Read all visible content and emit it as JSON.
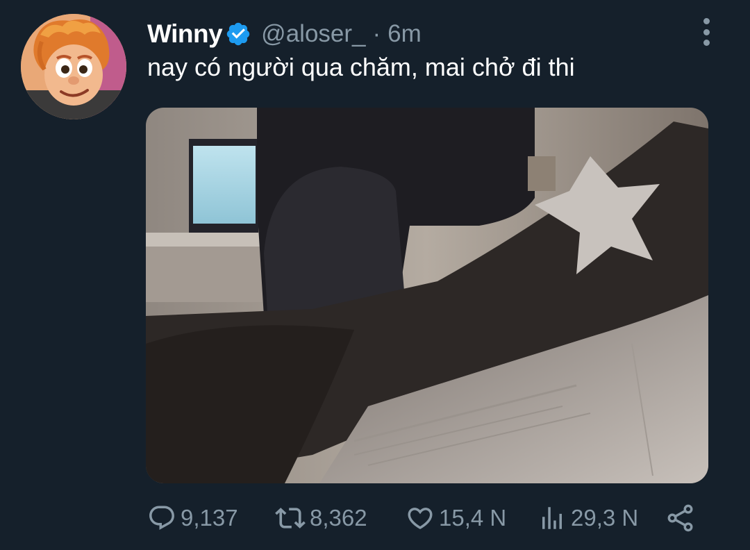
{
  "tweet": {
    "author": {
      "name": "Winny",
      "handle": "@aloser_",
      "verified": true
    },
    "separator": "·",
    "time": "6m",
    "text": "nay có người qua chăm, mai chở đi thi",
    "actions": {
      "replies": "9,137",
      "retweets": "8,362",
      "likes": "15,4 N",
      "views": "29,3 N"
    }
  },
  "icons": {
    "reply": "reply-icon",
    "retweet": "retweet-icon",
    "like": "heart-icon",
    "views": "views-icon",
    "share": "share-icon",
    "more": "more-vertical-icon",
    "verified": "verified-badge-icon"
  },
  "colors": {
    "background": "#15202b",
    "secondary_text": "#8899a6",
    "verified_blue": "#1d9bf0",
    "primary_text": "#ffffff"
  }
}
